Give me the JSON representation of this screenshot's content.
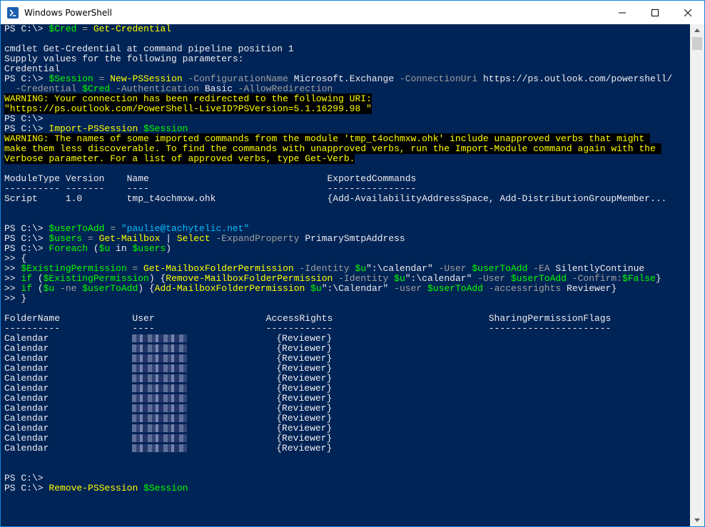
{
  "window": {
    "title": "Windows PowerShell",
    "icons": {
      "app": "powershell-icon",
      "minimize": "minimize-icon",
      "maximize": "maximize-icon",
      "close": "close-icon"
    }
  },
  "terminal": {
    "lines": [
      [
        [
          "PS C:\\> ",
          "w"
        ],
        [
          "$Cred",
          "v"
        ],
        [
          " = ",
          "g"
        ],
        [
          "Get-Credential",
          "y"
        ]
      ],
      [
        [
          "",
          ""
        ]
      ],
      [
        [
          "cmdlet Get-Credential at command pipeline position 1",
          "w"
        ]
      ],
      [
        [
          "Supply values for the following parameters:",
          "w"
        ]
      ],
      [
        [
          "Credential",
          "w"
        ]
      ],
      [
        [
          "PS C:\\> ",
          "w"
        ],
        [
          "$Session",
          "v"
        ],
        [
          " = ",
          "g"
        ],
        [
          "New-PSSession",
          "y"
        ],
        [
          " -ConfigurationName ",
          "g"
        ],
        [
          "Microsoft.Exchange",
          "w"
        ],
        [
          " -ConnectionUri ",
          "g"
        ],
        [
          "https://ps.outlook.com/powershell/",
          "w"
        ]
      ],
      [
        [
          "  -Credential ",
          "g"
        ],
        [
          "$Cred",
          "v"
        ],
        [
          " -Authentication ",
          "g"
        ],
        [
          "Basic",
          "w"
        ],
        [
          " -AllowRedirection",
          "g"
        ]
      ],
      [
        [
          "WARNING: Your connection has been redirected to the following URI:",
          "warn"
        ]
      ],
      [
        [
          "\"https://ps.outlook.com/PowerShell-LiveID?PSVersion=5.1.16299.98 \"",
          "warn"
        ]
      ],
      [
        [
          "PS C:\\>",
          "w"
        ]
      ],
      [
        [
          "PS C:\\> ",
          "w"
        ],
        [
          "Import-PSSession",
          "y"
        ],
        [
          " ",
          "w"
        ],
        [
          "$Session",
          "v"
        ]
      ],
      [
        [
          "WARNING: The names of some imported commands from the module 'tmp_t4ochmxw.ohk' include unapproved verbs that might ",
          "warn"
        ]
      ],
      [
        [
          "make them less discoverable. To find the commands with unapproved verbs, run the Import-Module command again with the ",
          "warn"
        ]
      ],
      [
        [
          "Verbose parameter. For a list of approved verbs, type Get-Verb.",
          "warn"
        ]
      ],
      [
        [
          "",
          ""
        ]
      ],
      [
        [
          "ModuleType Version    Name                                ExportedCommands",
          "w"
        ]
      ],
      [
        [
          "---------- -------    ----                                ----------------",
          "w"
        ]
      ],
      [
        [
          "Script     1.0        tmp_t4ochmxw.ohk                    {Add-AvailabilityAddressSpace, Add-DistributionGroupMember...",
          "w"
        ]
      ],
      [
        [
          "",
          ""
        ]
      ],
      [
        [
          "",
          ""
        ]
      ],
      [
        [
          "PS C:\\> ",
          "w"
        ],
        [
          "$userToAdd",
          "v"
        ],
        [
          " = ",
          "g"
        ],
        [
          "\"paulie@tachytelic.net\"",
          "s"
        ]
      ],
      [
        [
          "PS C:\\> ",
          "w"
        ],
        [
          "$users",
          "v"
        ],
        [
          " = ",
          "g"
        ],
        [
          "Get-Mailbox",
          "y"
        ],
        [
          " | ",
          "w"
        ],
        [
          "Select",
          "y"
        ],
        [
          " -ExpandProperty ",
          "g"
        ],
        [
          "PrimarySmtpAddress",
          "w"
        ]
      ],
      [
        [
          "PS C:\\> ",
          "w"
        ],
        [
          "Foreach",
          "v"
        ],
        [
          " (",
          "w"
        ],
        [
          "$u",
          "v"
        ],
        [
          " in ",
          "w"
        ],
        [
          "$users",
          "v"
        ],
        [
          ")",
          "w"
        ]
      ],
      [
        [
          ">> {",
          "w"
        ]
      ],
      [
        [
          ">> ",
          "w"
        ],
        [
          "$ExistingPermission",
          "v"
        ],
        [
          " = ",
          "g"
        ],
        [
          "Get-MailboxFolderPermission",
          "y"
        ],
        [
          " -Identity ",
          "g"
        ],
        [
          "$u",
          "v"
        ],
        [
          "\":\\calendar\"",
          "w"
        ],
        [
          " -User ",
          "g"
        ],
        [
          "$userToAdd",
          "v"
        ],
        [
          " -EA ",
          "g"
        ],
        [
          "SilentlyContinue",
          "w"
        ]
      ],
      [
        [
          ">> ",
          "w"
        ],
        [
          "if",
          "v"
        ],
        [
          " (",
          "w"
        ],
        [
          "$ExistingPermission",
          "v"
        ],
        [
          ") {",
          "w"
        ],
        [
          "Remove-MailboxFolderPermission",
          "y"
        ],
        [
          " -Identity ",
          "g"
        ],
        [
          "$u",
          "v"
        ],
        [
          "\":\\calendar\"",
          "w"
        ],
        [
          " -User ",
          "g"
        ],
        [
          "$userToAdd",
          "v"
        ],
        [
          " -Confirm:",
          "g"
        ],
        [
          "$False",
          "v"
        ],
        [
          "}",
          "w"
        ]
      ],
      [
        [
          ">> ",
          "w"
        ],
        [
          "if",
          "v"
        ],
        [
          " (",
          "w"
        ],
        [
          "$u",
          "v"
        ],
        [
          " -ne ",
          "g"
        ],
        [
          "$userToAdd",
          "v"
        ],
        [
          ") {",
          "w"
        ],
        [
          "Add-MailboxFolderPermission",
          "y"
        ],
        [
          " ",
          "w"
        ],
        [
          "$u",
          "v"
        ],
        [
          "\":\\Calendar\"",
          "w"
        ],
        [
          " -user ",
          "g"
        ],
        [
          "$userToAdd",
          "v"
        ],
        [
          " -accessrights ",
          "g"
        ],
        [
          "Reviewer",
          "w"
        ],
        [
          "}",
          "w"
        ]
      ],
      [
        [
          ">> }",
          "w"
        ]
      ],
      [
        [
          "",
          ""
        ]
      ],
      [
        [
          "FolderName             User                    AccessRights                            SharingPermissionFlags",
          "w"
        ]
      ],
      [
        [
          "----------             ----                    ------------                            ----------------------",
          "w"
        ]
      ],
      [
        [
          "Calendar               ",
          "w"
        ],
        [
          "",
          "blur"
        ],
        [
          "                {Reviewer}",
          "w"
        ]
      ],
      [
        [
          "Calendar               ",
          "w"
        ],
        [
          "",
          "blur"
        ],
        [
          "                {Reviewer}",
          "w"
        ]
      ],
      [
        [
          "Calendar               ",
          "w"
        ],
        [
          "",
          "blur"
        ],
        [
          "                {Reviewer}",
          "w"
        ]
      ],
      [
        [
          "Calendar               ",
          "w"
        ],
        [
          "",
          "blur"
        ],
        [
          "                {Reviewer}",
          "w"
        ]
      ],
      [
        [
          "Calendar               ",
          "w"
        ],
        [
          "",
          "blur"
        ],
        [
          "                {Reviewer}",
          "w"
        ]
      ],
      [
        [
          "Calendar               ",
          "w"
        ],
        [
          "",
          "blur"
        ],
        [
          "                {Reviewer}",
          "w"
        ]
      ],
      [
        [
          "Calendar               ",
          "w"
        ],
        [
          "",
          "blur"
        ],
        [
          "                {Reviewer}",
          "w"
        ]
      ],
      [
        [
          "Calendar               ",
          "w"
        ],
        [
          "",
          "blur"
        ],
        [
          "                {Reviewer}",
          "w"
        ]
      ],
      [
        [
          "Calendar               ",
          "w"
        ],
        [
          "",
          "blur"
        ],
        [
          "                {Reviewer}",
          "w"
        ]
      ],
      [
        [
          "Calendar               ",
          "w"
        ],
        [
          "",
          "blur"
        ],
        [
          "                {Reviewer}",
          "w"
        ]
      ],
      [
        [
          "Calendar               ",
          "w"
        ],
        [
          "",
          "blur"
        ],
        [
          "                {Reviewer}",
          "w"
        ]
      ],
      [
        [
          "Calendar               ",
          "w"
        ],
        [
          "",
          "blur"
        ],
        [
          "                {Reviewer}",
          "w"
        ]
      ],
      [
        [
          "",
          ""
        ]
      ],
      [
        [
          "",
          ""
        ]
      ],
      [
        [
          "PS C:\\>",
          "w"
        ]
      ],
      [
        [
          "PS C:\\> ",
          "w"
        ],
        [
          "Remove-PSSession",
          "y"
        ],
        [
          " ",
          "w"
        ],
        [
          "$Session",
          "v"
        ]
      ]
    ]
  },
  "scrollbar": {
    "up": "scroll-up-arrow-icon",
    "down": "scroll-down-arrow-icon"
  }
}
